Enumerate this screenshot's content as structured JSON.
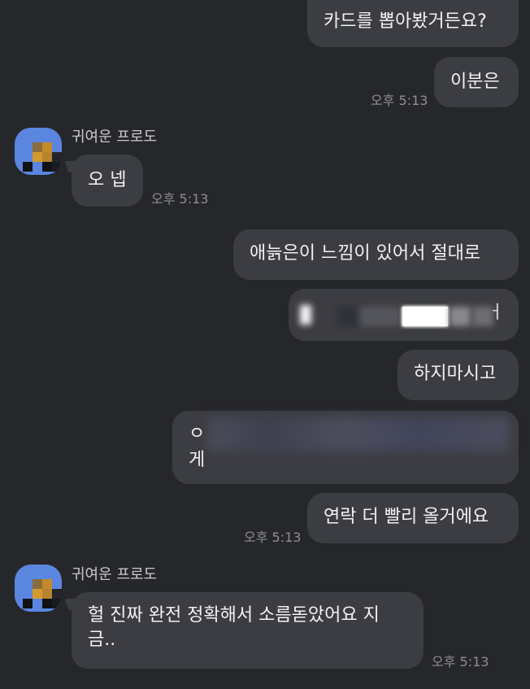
{
  "sender": {
    "name": "귀여운 프로도"
  },
  "messages": {
    "m1": "카드를 뽑아봤거든요?",
    "m2": "이분은",
    "m2_time": "오후 5:13",
    "m3": "오 넵",
    "m3_time": "오후 5:13",
    "m4": "애늙은이 느낌이 있어서 절대로",
    "m5_tail": "ㅓ",
    "m6": "하지마시고",
    "m7_head": "ㅇ",
    "m7_line2": "게",
    "m8": "연락 더 빨리 올거에요",
    "m8_time": "오후 5:13",
    "m9_line1": "헐 진짜 완전 정확해서 소름돋았어요 지",
    "m9_line2": "금..",
    "m9_time": "오후 5:13"
  },
  "colors": {
    "background": "#26272b",
    "bubble": "#3c3d42",
    "avatar": "#5a86e0",
    "timestamp": "#8e8f94"
  }
}
